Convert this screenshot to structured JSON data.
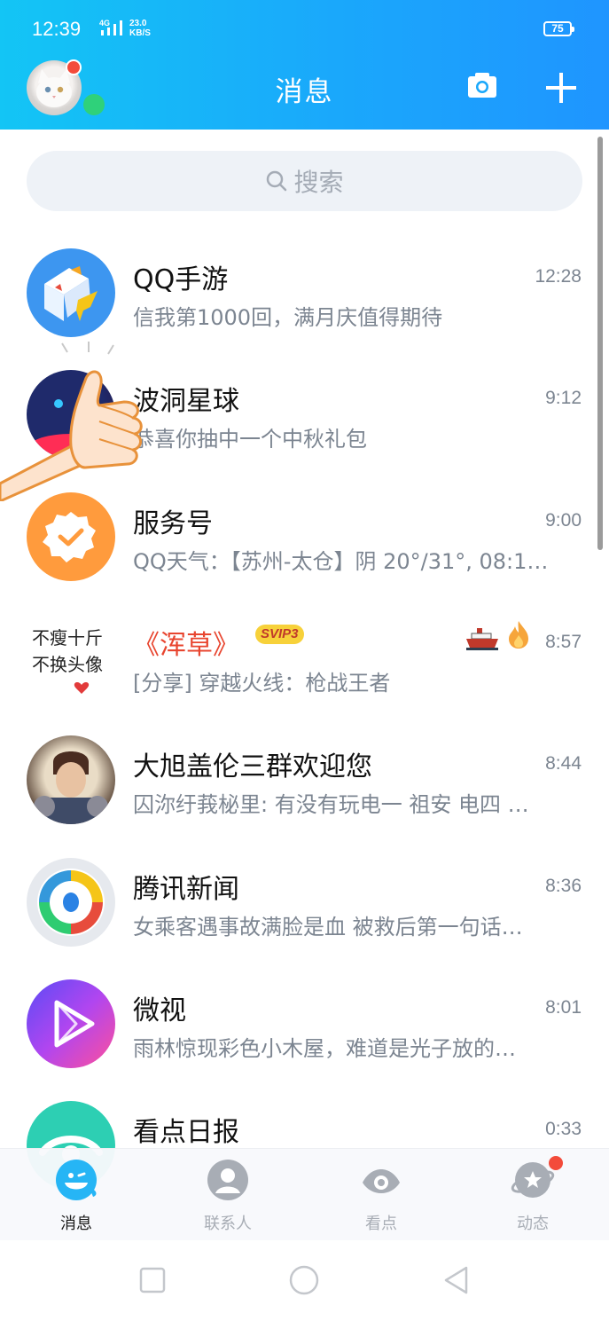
{
  "status_bar": {
    "time": "12:39",
    "network": "4G",
    "speed_value": "23.0",
    "speed_unit": "KB/S",
    "battery": "75"
  },
  "header": {
    "title": "消息"
  },
  "search": {
    "placeholder": "搜索"
  },
  "chats": [
    {
      "name": "QQ手游",
      "time": "12:28",
      "preview": "信我第1000回，满月庆值得期待"
    },
    {
      "name": "波洞星球",
      "time": "9:12",
      "preview": "恭喜你抽中一个中秋礼包"
    },
    {
      "name": "服务号",
      "time": "9:00",
      "preview": "QQ天气：【苏州-太仓】阴 20°/31°, 08:1…"
    },
    {
      "name": "《浑草》",
      "badge": "SVIP3",
      "time": "8:57",
      "preview": "[分享] 穿越火线：枪战王者",
      "avatar_text_1": "不瘦十斤",
      "avatar_text_2": "不换头像"
    },
    {
      "name": "大旭盖伦三群欢迎您",
      "time": "8:44",
      "preview": "囚沵纡莪柲里: 有没有玩电一 祖安  电四 …"
    },
    {
      "name": "腾讯新闻",
      "time": "8:36",
      "preview": "女乘客遇事故满脸是血 被救后第一句话…"
    },
    {
      "name": "微视",
      "time": "8:01",
      "preview": "雨林惊现彩色小木屋，难道是光子放的…"
    },
    {
      "name": "看点日报",
      "time": "0:33",
      "preview": ""
    }
  ],
  "bottom_nav": [
    {
      "label": "消息",
      "active": true
    },
    {
      "label": "联系人",
      "active": false
    },
    {
      "label": "看点",
      "active": false
    },
    {
      "label": "动态",
      "active": false
    }
  ],
  "colors": {
    "header_start": "#13c5f5",
    "header_end": "#1f95ff",
    "badge_red": "#f34b3a",
    "online_green": "#2fd17a"
  }
}
